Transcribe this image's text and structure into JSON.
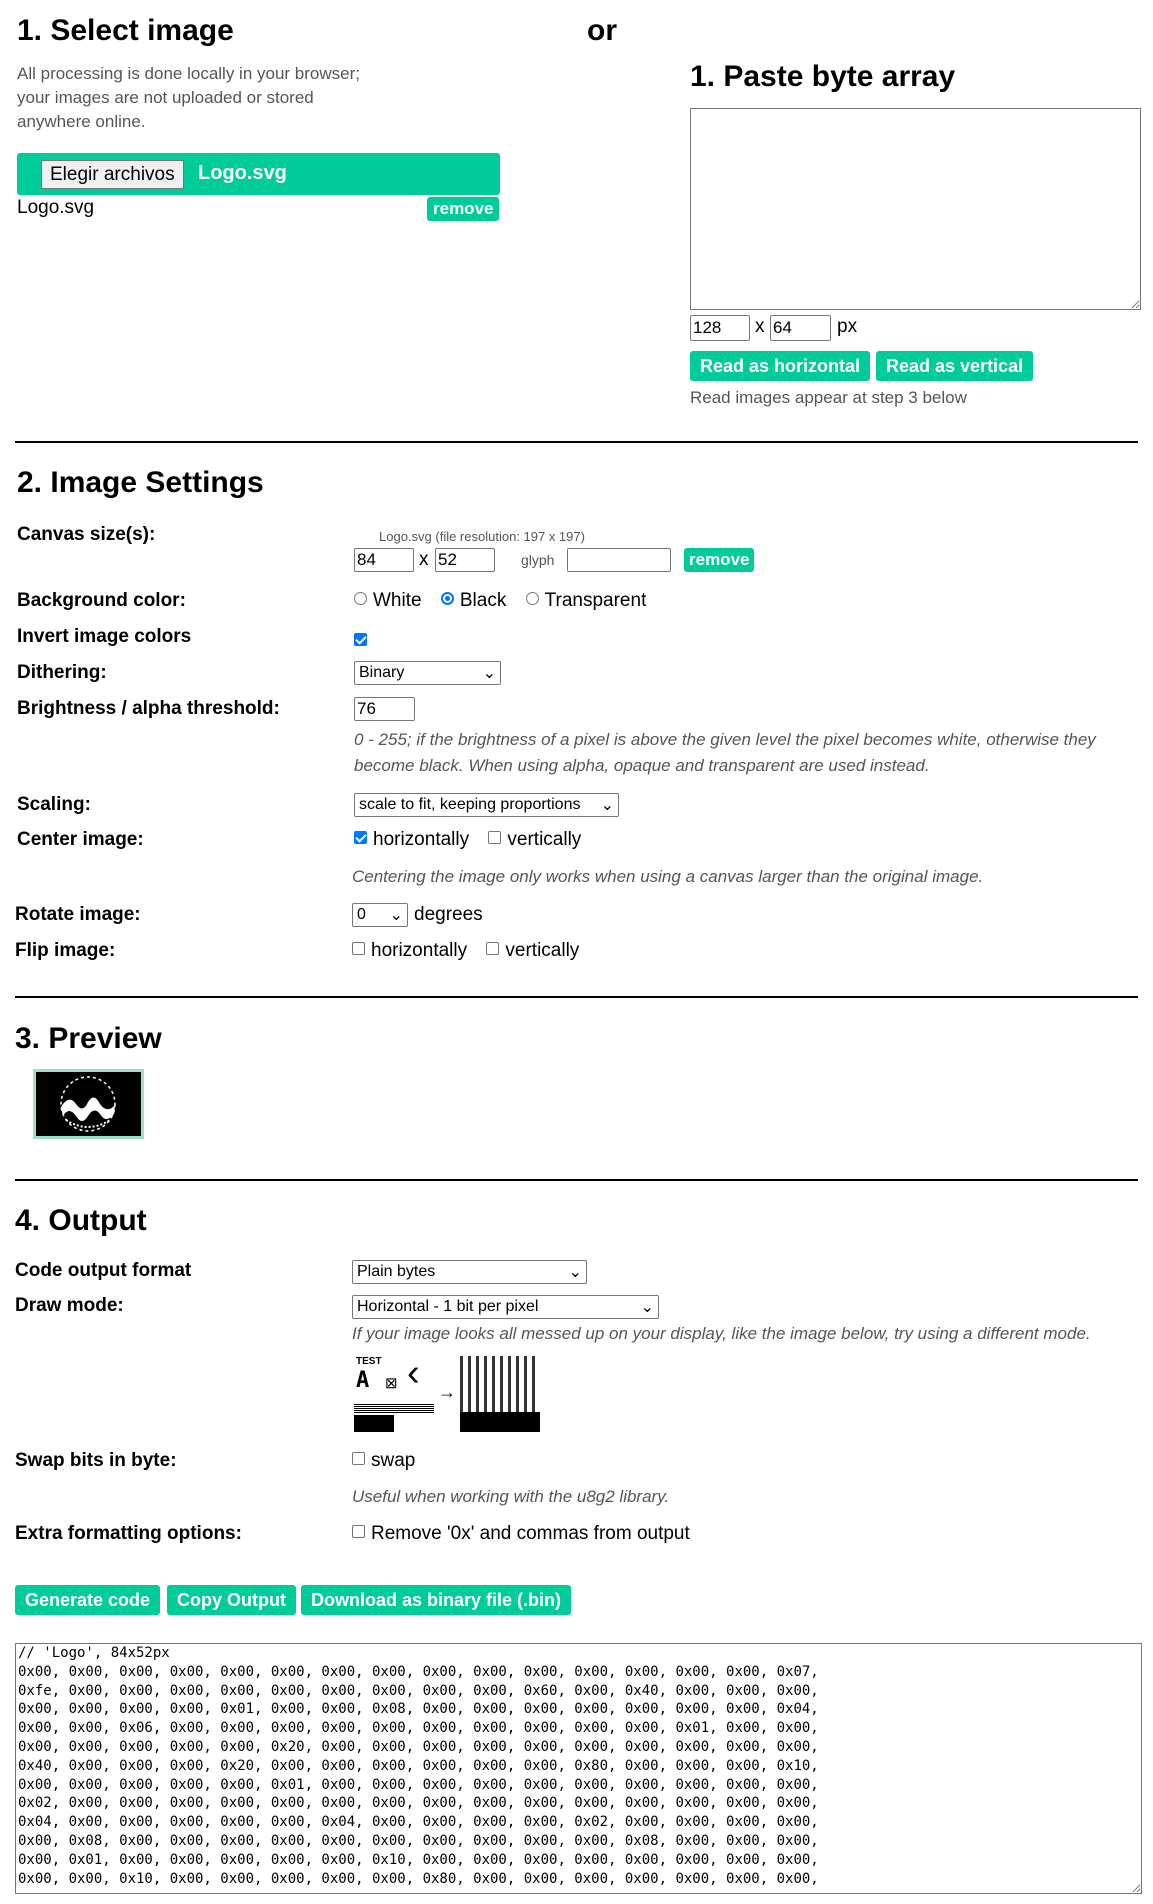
{
  "accent": "#00cc99",
  "select": {
    "title": "1. Select image",
    "note": [
      "All processing is done locally in your browser;",
      "your images are not uploaded or stored",
      "anywhere online."
    ],
    "choose_label": "Elegir archivos",
    "chosen_file": "Logo.svg",
    "file_name": "Logo.svg",
    "remove": "remove"
  },
  "or": "or",
  "paste": {
    "title": "1. Paste byte array",
    "textarea": "",
    "width": "128",
    "x": "x",
    "height": "64",
    "px": "px",
    "read_h": "Read as horizontal",
    "read_v": "Read as vertical",
    "note": "Read images appear at step 3 below"
  },
  "settings": {
    "title": "2. Image Settings",
    "canvas_label": "Canvas size(s):",
    "file_res": "Logo.svg (file resolution: 197 x 197)",
    "cw": "84",
    "x": "x",
    "ch": "52",
    "glyph": "glyph",
    "glyph_value": "",
    "remove": "remove",
    "bg_label": "Background color:",
    "bg_options": [
      "White",
      "Black",
      "Transparent"
    ],
    "bg_selected": "Black",
    "invert_label": "Invert image colors",
    "invert": true,
    "dither_label": "Dithering:",
    "dither": "Binary",
    "bright_label": "Brightness / alpha threshold:",
    "bright": "76",
    "bright_help": [
      "0 - 255; if the brightness of a pixel is above the given level the pixel becomes white, otherwise they",
      "become black. When using alpha, opaque and transparent are used instead."
    ],
    "scaling_label": "Scaling:",
    "scaling": "scale to fit, keeping proportions",
    "center_label": "Center image:",
    "center_h": "horizontally",
    "center_h_on": true,
    "center_v": "vertically",
    "center_v_on": false,
    "center_note": "Centering the image only works when using a canvas larger than the original image.",
    "rotate_label": "Rotate image:",
    "rotate": "0",
    "degrees": "degrees",
    "flip_label": "Flip image:",
    "flip_h": "horizontally",
    "flip_v": "vertically"
  },
  "preview": {
    "title": "3. Preview"
  },
  "output": {
    "title": "4. Output",
    "format_label": "Code output format",
    "format": "Plain bytes",
    "draw_label": "Draw mode:",
    "draw": "Horizontal - 1 bit per pixel",
    "draw_note": "If your image looks all messed up on your display, like the image below, try using a different mode.",
    "illus_text": "TEST",
    "swap_label": "Swap bits in byte:",
    "swap": "swap",
    "swap_note": "Useful when working with the u8g2 library.",
    "extra_label": "Extra formatting options:",
    "extra": "Remove '0x' and commas from output",
    "generate": "Generate code",
    "copy": "Copy Output",
    "download": "Download as binary file (.bin)",
    "code": [
      "// 'Logo', 84x52px",
      "0x00, 0x00, 0x00, 0x00, 0x00, 0x00, 0x00, 0x00, 0x00, 0x00, 0x00, 0x00, 0x00, 0x00, 0x00, 0x07,",
      "0xfe, 0x00, 0x00, 0x00, 0x00, 0x00, 0x00, 0x00, 0x00, 0x00, 0x60, 0x00, 0x40, 0x00, 0x00, 0x00,",
      "0x00, 0x00, 0x00, 0x00, 0x01, 0x00, 0x00, 0x08, 0x00, 0x00, 0x00, 0x00, 0x00, 0x00, 0x00, 0x04,",
      "0x00, 0x00, 0x06, 0x00, 0x00, 0x00, 0x00, 0x00, 0x00, 0x00, 0x00, 0x00, 0x00, 0x01, 0x00, 0x00,",
      "0x00, 0x00, 0x00, 0x00, 0x00, 0x20, 0x00, 0x00, 0x00, 0x00, 0x00, 0x00, 0x00, 0x00, 0x00, 0x00,",
      "0x40, 0x00, 0x00, 0x00, 0x20, 0x00, 0x00, 0x00, 0x00, 0x00, 0x00, 0x80, 0x00, 0x00, 0x00, 0x10,",
      "0x00, 0x00, 0x00, 0x00, 0x00, 0x01, 0x00, 0x00, 0x00, 0x00, 0x00, 0x00, 0x00, 0x00, 0x00, 0x00,",
      "0x02, 0x00, 0x00, 0x00, 0x00, 0x00, 0x00, 0x00, 0x00, 0x00, 0x00, 0x00, 0x00, 0x00, 0x00, 0x00,",
      "0x04, 0x00, 0x00, 0x00, 0x00, 0x00, 0x04, 0x00, 0x00, 0x00, 0x00, 0x02, 0x00, 0x00, 0x00, 0x00,",
      "0x00, 0x08, 0x00, 0x00, 0x00, 0x00, 0x00, 0x00, 0x00, 0x00, 0x00, 0x00, 0x08, 0x00, 0x00, 0x00,",
      "0x00, 0x01, 0x00, 0x00, 0x00, 0x00, 0x00, 0x10, 0x00, 0x00, 0x00, 0x00, 0x00, 0x00, 0x00, 0x00,",
      "0x00, 0x00, 0x10, 0x00, 0x00, 0x00, 0x00, 0x00, 0x80, 0x00, 0x00, 0x00, 0x00, 0x00, 0x00, 0x00,"
    ]
  }
}
